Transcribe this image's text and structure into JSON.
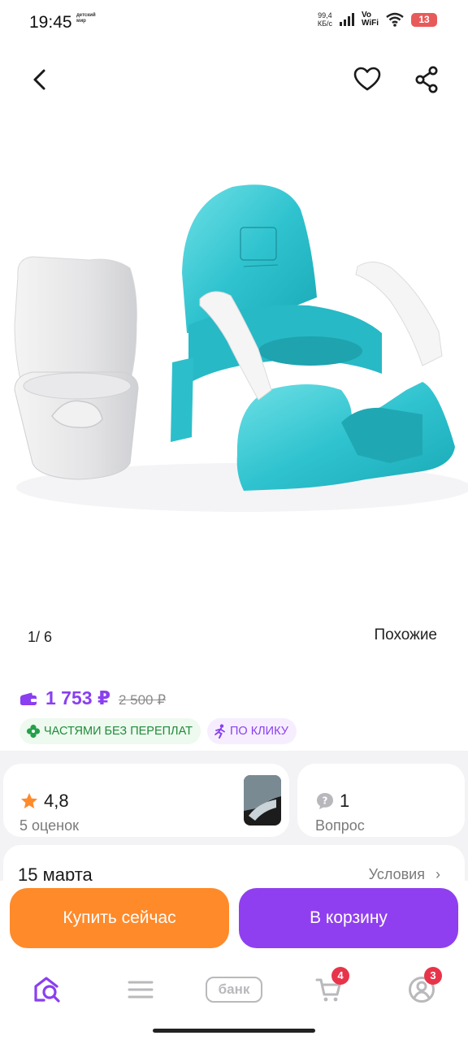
{
  "status_bar": {
    "time": "19:45",
    "app_logo_lines": [
      "детский",
      "мир"
    ],
    "net_speed_value": "99,4",
    "net_speed_unit": "КБ/с",
    "vowifi_line1": "Vo",
    "vowifi_line2": "WiFi",
    "battery": "13"
  },
  "gallery": {
    "counter": "1/ 6",
    "similar_label": "Похожие"
  },
  "price": {
    "current": "1 753 ₽",
    "old": "2 500 ₽",
    "accent_color": "#8a3ff0"
  },
  "badges": [
    {
      "label": "ЧАСТЯМИ БЕЗ ПЕРЕПЛАТ",
      "icon": "clover-icon"
    },
    {
      "label": "ПО КЛИКУ",
      "icon": "running-man-icon"
    }
  ],
  "rating": {
    "value": "4,8",
    "count_label": "5 оценок"
  },
  "questions": {
    "count": "1",
    "label": "Вопрос"
  },
  "delivery": {
    "date": "15 марта",
    "terms_label": "Условия"
  },
  "actions": {
    "buy_now": "Купить сейчас",
    "add_to_cart": "В корзину",
    "buy_color": "#ff8a2a",
    "cart_color": "#8f3fef"
  },
  "bottom_nav": {
    "bank_label": "банк",
    "cart_badge": "4",
    "profile_badge": "3"
  }
}
